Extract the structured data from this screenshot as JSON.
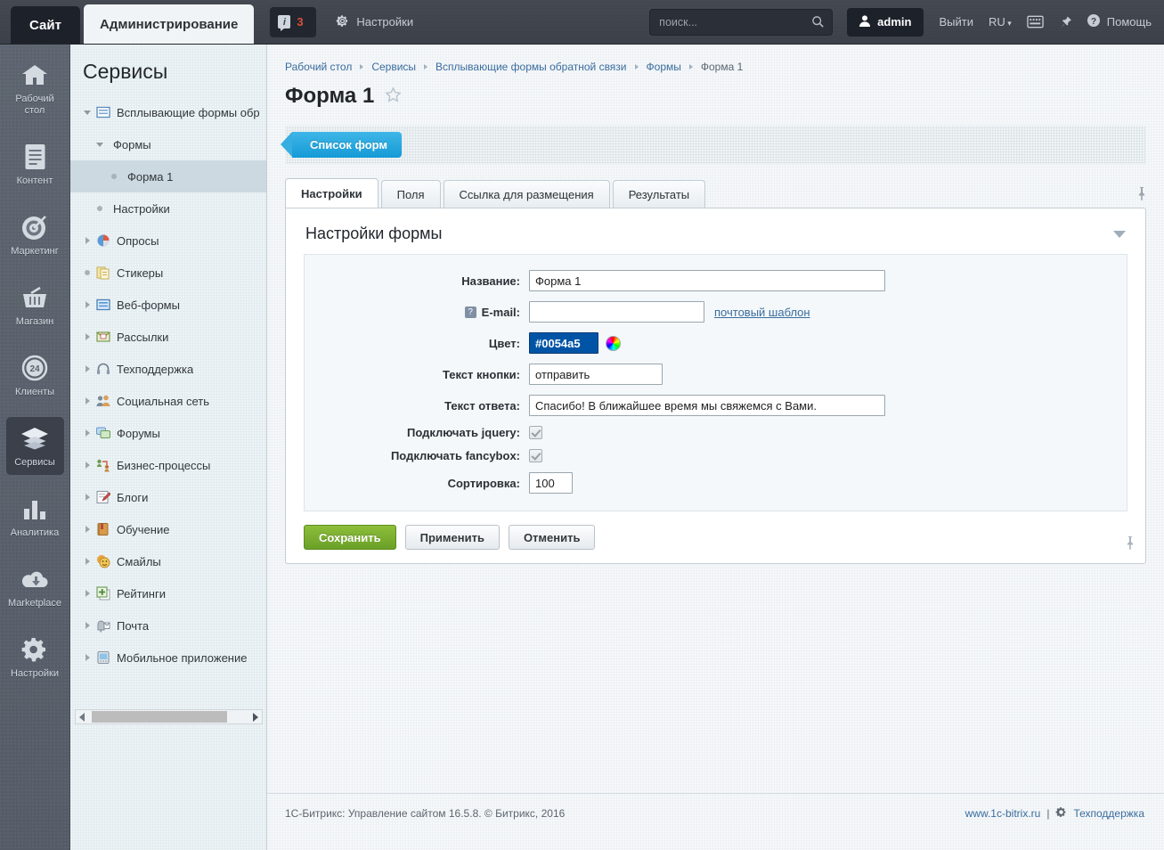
{
  "topbar": {
    "site_tab": "Сайт",
    "admin_tab": "Администрирование",
    "notif_count": "3",
    "settings": "Настройки",
    "search_placeholder": "поиск...",
    "user": "admin",
    "logout": "Выйти",
    "lang": "RU",
    "help": "Помощь"
  },
  "rail": {
    "items": [
      {
        "label": "Рабочий стол",
        "icon": "home-icon",
        "active": false
      },
      {
        "label": "Контент",
        "icon": "document-icon",
        "active": false
      },
      {
        "label": "Маркетинг",
        "icon": "target-icon",
        "active": false
      },
      {
        "label": "Магазин",
        "icon": "basket-icon",
        "active": false
      },
      {
        "label": "Клиенты",
        "icon": "clients-24-icon",
        "active": false
      },
      {
        "label": "Сервисы",
        "icon": "layers-icon",
        "active": true
      },
      {
        "label": "Аналитика",
        "icon": "bar-chart-icon",
        "active": false
      },
      {
        "label": "Marketplace",
        "icon": "cloud-download-icon",
        "active": false
      },
      {
        "label": "Настройки",
        "icon": "gear-icon",
        "active": false
      }
    ]
  },
  "sidebar": {
    "title": "Сервисы",
    "items": [
      {
        "label": "Всплывающие формы обр",
        "level": 1,
        "marker": "tri-d",
        "icon": "form-icon",
        "selected": false
      },
      {
        "label": "Формы",
        "level": 2,
        "marker": "tri-d",
        "icon": "none",
        "selected": false
      },
      {
        "label": "Форма 1",
        "level": 3,
        "marker": "dot",
        "icon": "none",
        "selected": true
      },
      {
        "label": "Настройки",
        "level": 2,
        "marker": "dot",
        "icon": "none",
        "selected": false
      },
      {
        "label": "Опросы",
        "level": 1,
        "marker": "tri-r",
        "icon": "poll-icon",
        "selected": false
      },
      {
        "label": "Стикеры",
        "level": 1,
        "marker": "dot",
        "icon": "sticker-icon",
        "selected": false
      },
      {
        "label": "Веб-формы",
        "level": 1,
        "marker": "tri-r",
        "icon": "webform-icon",
        "selected": false
      },
      {
        "label": "Рассылки",
        "level": 1,
        "marker": "tri-r",
        "icon": "envelope-icon",
        "selected": false
      },
      {
        "label": "Техподдержка",
        "level": 1,
        "marker": "tri-r",
        "icon": "headset-icon",
        "selected": false
      },
      {
        "label": "Социальная сеть",
        "level": 1,
        "marker": "tri-r",
        "icon": "people-icon",
        "selected": false
      },
      {
        "label": "Форумы",
        "level": 1,
        "marker": "tri-r",
        "icon": "chat-icon",
        "selected": false
      },
      {
        "label": "Бизнес-процессы",
        "level": 1,
        "marker": "tri-r",
        "icon": "workflow-icon",
        "selected": false
      },
      {
        "label": "Блоги",
        "level": 1,
        "marker": "tri-r",
        "icon": "pencil-note-icon",
        "selected": false
      },
      {
        "label": "Обучение",
        "level": 1,
        "marker": "tri-r",
        "icon": "book-icon",
        "selected": false
      },
      {
        "label": "Смайлы",
        "level": 1,
        "marker": "tri-r",
        "icon": "smiley-icon",
        "selected": false
      },
      {
        "label": "Рейтинги",
        "level": 1,
        "marker": "tri-r",
        "icon": "plus-card-icon",
        "selected": false
      },
      {
        "label": "Почта",
        "level": 1,
        "marker": "tri-r",
        "icon": "mailbox-icon",
        "selected": false
      },
      {
        "label": "Мобильное приложение",
        "level": 1,
        "marker": "tri-r",
        "icon": "mobile-icon",
        "selected": false
      }
    ]
  },
  "breadcrumb": [
    "Рабочий стол",
    "Сервисы",
    "Всплывающие формы обратной связи",
    "Формы",
    "Форма 1"
  ],
  "page": {
    "title": "Форма 1",
    "toolbar_button": "Список форм"
  },
  "tabs": [
    {
      "label": "Настройки",
      "active": true
    },
    {
      "label": "Поля",
      "active": false
    },
    {
      "label": "Ссылка для размещения",
      "active": false
    },
    {
      "label": "Результаты",
      "active": false
    }
  ],
  "panel": {
    "title": "Настройки формы",
    "fields": {
      "name_label": "Название:",
      "name_value": "Форма 1",
      "email_label": "E-mail:",
      "email_value": "",
      "email_link": "почтовый шаблон",
      "color_label": "Цвет:",
      "color_value": "#0054a5",
      "button_text_label": "Текст кнопки:",
      "button_text_value": "отправить",
      "answer_label": "Текст ответа:",
      "answer_value": "Спасибо! В ближайшее время мы свяжемся с Вами.",
      "jquery_label": "Подключать jquery:",
      "fancybox_label": "Подключать fancybox:",
      "sort_label": "Сортировка:",
      "sort_value": "100"
    },
    "buttons": {
      "save": "Сохранить",
      "apply": "Применить",
      "cancel": "Отменить"
    }
  },
  "footer": {
    "left": "1С-Битрикс: Управление сайтом 16.5.8. © Битрикс, 2016",
    "site": "www.1c-bitrix.ru",
    "sep": "|",
    "support": "Техподдержка"
  },
  "colors": {
    "accent_blue": "#159ad6",
    "save_green": "#6ba028",
    "color_field": "#0054a5"
  }
}
